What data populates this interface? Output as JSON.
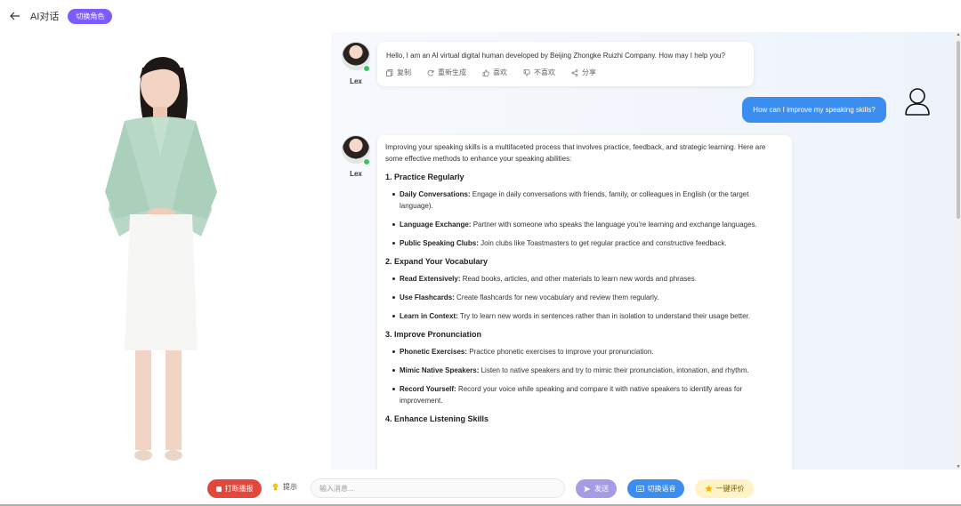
{
  "header": {
    "title": "AI对话",
    "switch_role_label": "切换角色"
  },
  "bot": {
    "name": "Lex"
  },
  "messages": {
    "greeting": "Hello, I am an AI virtual digital human developed by Beijing Zhongke Ruizhi Company. How may I help you?",
    "actions": {
      "copy": "复制",
      "regenerate": "重新生成",
      "like": "喜欢",
      "dislike": "不喜欢",
      "share": "分享"
    },
    "user_question": "How can I improve my speaking skills?",
    "answer": {
      "intro": "Improving your speaking skills is a multifaceted process that involves practice, feedback, and strategic learning. Here are some effective methods to enhance your speaking abilities:",
      "sections": [
        {
          "heading": "1. Practice Regularly",
          "items": [
            {
              "term": "Daily Conversations:",
              "text": " Engage in daily conversations with friends, family, or colleagues in English (or the target language)."
            },
            {
              "term": "Language Exchange:",
              "text": " Partner with someone who speaks the language you're learning and exchange languages."
            },
            {
              "term": "Public Speaking Clubs:",
              "text": " Join clubs like Toastmasters to get regular practice and constructive feedback."
            }
          ]
        },
        {
          "heading": "2. Expand Your Vocabulary",
          "items": [
            {
              "term": "Read Extensively:",
              "text": " Read books, articles, and other materials to learn new words and phrases."
            },
            {
              "term": "Use Flashcards:",
              "text": " Create flashcards for new vocabulary and review them regularly."
            },
            {
              "term": "Learn in Context:",
              "text": " Try to learn new words in sentences rather than in isolation to understand their usage better."
            }
          ]
        },
        {
          "heading": "3. Improve Pronunciation",
          "items": [
            {
              "term": "Phonetic Exercises:",
              "text": " Practice phonetic exercises to improve your pronunciation."
            },
            {
              "term": "Mimic Native Speakers:",
              "text": " Listen to native speakers and try to mimic their pronunciation, intonation, and rhythm."
            },
            {
              "term": "Record Yourself:",
              "text": " Record your voice while speaking and compare it with native speakers to identify areas for improvement."
            }
          ]
        },
        {
          "heading": "4. Enhance Listening Skills",
          "items": []
        }
      ]
    }
  },
  "bottom": {
    "stop_label": "打断播报",
    "hint_label": "提示",
    "input_placeholder": "输入消息...",
    "send_label": "发送",
    "voice_label": "切换语音",
    "rate_label": "一键评价"
  },
  "colors": {
    "accent_purple": "#7c5cff",
    "user_bubble": "#3b8ef0",
    "stop_red": "#e2473b",
    "online_green": "#3cc45a"
  }
}
